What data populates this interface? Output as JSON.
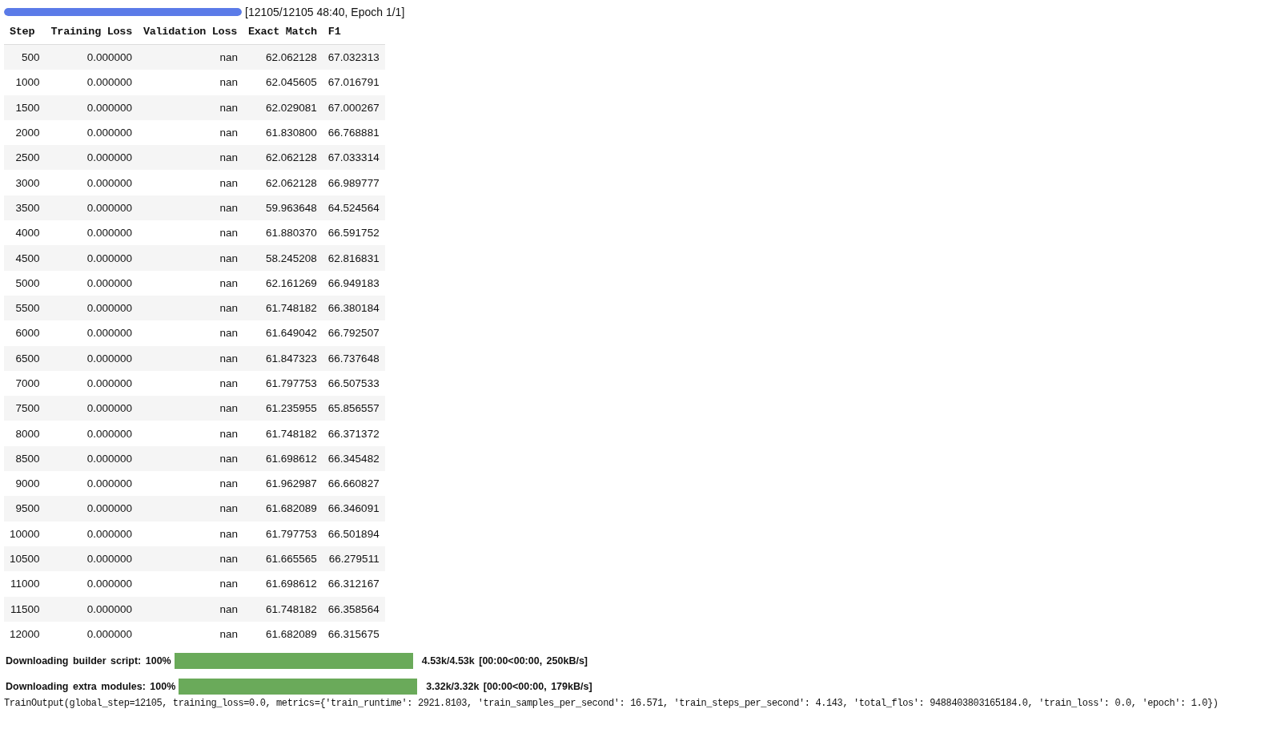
{
  "training_progress": {
    "level": 1,
    "text": "[12105/12105 48:40, Epoch 1/1]"
  },
  "table": {
    "columns": [
      "Step",
      "Training Loss",
      "Validation Loss",
      "Exact Match",
      "F1"
    ],
    "rows": [
      [
        "500",
        "0.000000",
        "nan",
        "62.062128",
        "67.032313"
      ],
      [
        "1000",
        "0.000000",
        "nan",
        "62.045605",
        "67.016791"
      ],
      [
        "1500",
        "0.000000",
        "nan",
        "62.029081",
        "67.000267"
      ],
      [
        "2000",
        "0.000000",
        "nan",
        "61.830800",
        "66.768881"
      ],
      [
        "2500",
        "0.000000",
        "nan",
        "62.062128",
        "67.033314"
      ],
      [
        "3000",
        "0.000000",
        "nan",
        "62.062128",
        "66.989777"
      ],
      [
        "3500",
        "0.000000",
        "nan",
        "59.963648",
        "64.524564"
      ],
      [
        "4000",
        "0.000000",
        "nan",
        "61.880370",
        "66.591752"
      ],
      [
        "4500",
        "0.000000",
        "nan",
        "58.245208",
        "62.816831"
      ],
      [
        "5000",
        "0.000000",
        "nan",
        "62.161269",
        "66.949183"
      ],
      [
        "5500",
        "0.000000",
        "nan",
        "61.748182",
        "66.380184"
      ],
      [
        "6000",
        "0.000000",
        "nan",
        "61.649042",
        "66.792507"
      ],
      [
        "6500",
        "0.000000",
        "nan",
        "61.847323",
        "66.737648"
      ],
      [
        "7000",
        "0.000000",
        "nan",
        "61.797753",
        "66.507533"
      ],
      [
        "7500",
        "0.000000",
        "nan",
        "61.235955",
        "65.856557"
      ],
      [
        "8000",
        "0.000000",
        "nan",
        "61.748182",
        "66.371372"
      ],
      [
        "8500",
        "0.000000",
        "nan",
        "61.698612",
        "66.345482"
      ],
      [
        "9000",
        "0.000000",
        "nan",
        "61.962987",
        "66.660827"
      ],
      [
        "9500",
        "0.000000",
        "nan",
        "61.682089",
        "66.346091"
      ],
      [
        "10000",
        "0.000000",
        "nan",
        "61.797753",
        "66.501894"
      ],
      [
        "10500",
        "0.000000",
        "nan",
        "61.665565",
        "66.279511"
      ],
      [
        "11000",
        "0.000000",
        "nan",
        "61.698612",
        "66.312167"
      ],
      [
        "11500",
        "0.000000",
        "nan",
        "61.748182",
        "66.358564"
      ],
      [
        "12000",
        "0.000000",
        "nan",
        "61.682089",
        "66.315675"
      ]
    ]
  },
  "downloads": [
    {
      "label": "Downloading builder script: 100%",
      "level": 1,
      "stats": "4.53k/4.53k [00:00<00:00, 250kB/s]"
    },
    {
      "label": "Downloading extra modules: 100%",
      "level": 1,
      "stats": "3.32k/3.32k [00:00<00:00, 179kB/s]"
    }
  ],
  "output": "TrainOutput(global_step=12105, training_loss=0.0, metrics={'train_runtime': 2921.8103, 'train_samples_per_second': 16.571, 'train_steps_per_second': 4.143, 'total_flos': 9488403803165184.0, 'train_loss': 0.0, 'epoch': 1.0})"
}
